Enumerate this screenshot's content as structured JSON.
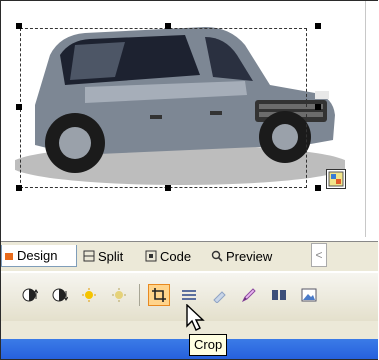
{
  "view_tabs": {
    "design": "Design",
    "split": "Split",
    "code": "Code",
    "preview": "Preview"
  },
  "toolbar": {
    "buttons": [
      "contrast-up-icon",
      "contrast-down-icon",
      "brightness-up-icon",
      "brightness-down-icon",
      "crop-icon",
      "line-style-icon",
      "set-transparent-color-icon",
      "color-picker-icon",
      "split-icon",
      "picture-icon"
    ],
    "active": "crop-icon",
    "accent": "#ffd48b",
    "accent_border": "#e8891f"
  },
  "tooltip": {
    "text": "Crop"
  },
  "colors": {
    "taskbar": "#245edc",
    "panel": "#ece9d8"
  }
}
